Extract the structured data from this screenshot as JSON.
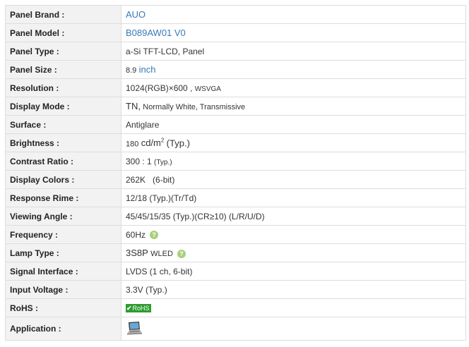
{
  "rows": [
    {
      "label": "Panel Brand :",
      "value": "AUO"
    },
    {
      "label": "Panel Model :",
      "value": "B089AW01 V0"
    },
    {
      "label": "Panel Type :",
      "value": "a-Si TFT-LCD, Panel"
    },
    {
      "label": "Panel Size :",
      "value_num": "8.9",
      "value_unit": "inch"
    },
    {
      "label": "Resolution :",
      "value_main": "1024(RGB)×600 ,",
      "value_extra": "WSVGA"
    },
    {
      "label": "Display Mode :",
      "value_main": "TN,",
      "value_extra": "Normally White, Transmissive"
    },
    {
      "label": "Surface :",
      "value": "Antiglare"
    },
    {
      "label": "Brightness :",
      "value_num": "180",
      "value_unit": "cd/m",
      "value_sup": "2",
      "value_extra": "(Typ.)"
    },
    {
      "label": "Contrast Ratio :",
      "value_main": "300 : 1",
      "value_extra": "(Typ.)"
    },
    {
      "label": "Display Colors :",
      "value": "262K   (6-bit)"
    },
    {
      "label": "Response Rime :",
      "value": "12/18 (Typ.)(Tr/Td)"
    },
    {
      "label": "Viewing Angle :",
      "value": "45/45/15/35 (Typ.)(CR≥10) (L/R/U/D)"
    },
    {
      "label": "Frequency :",
      "value": "60Hz",
      "help_icon": "question-circle-icon"
    },
    {
      "label": "Lamp Type :",
      "value_main": "3S8P",
      "value_extra": "WLED",
      "help_icon": "question-circle-icon"
    },
    {
      "label": "Signal Interface :",
      "value": "LVDS (1 ch, 6-bit)"
    },
    {
      "label": "Input Voltage :",
      "value": "3.3V (Typ.)"
    },
    {
      "label": "RoHS :",
      "badge": "RoHS",
      "badge_icon": "checkmark-icon",
      "badge_color": "#2e9b2e"
    },
    {
      "label": "Application :",
      "icon": "laptop-icon"
    }
  ],
  "colors": {
    "label_bg": "#f2f2f2",
    "link": "#3a79b6",
    "border": "#dddddd",
    "help": "#a8d07a"
  }
}
